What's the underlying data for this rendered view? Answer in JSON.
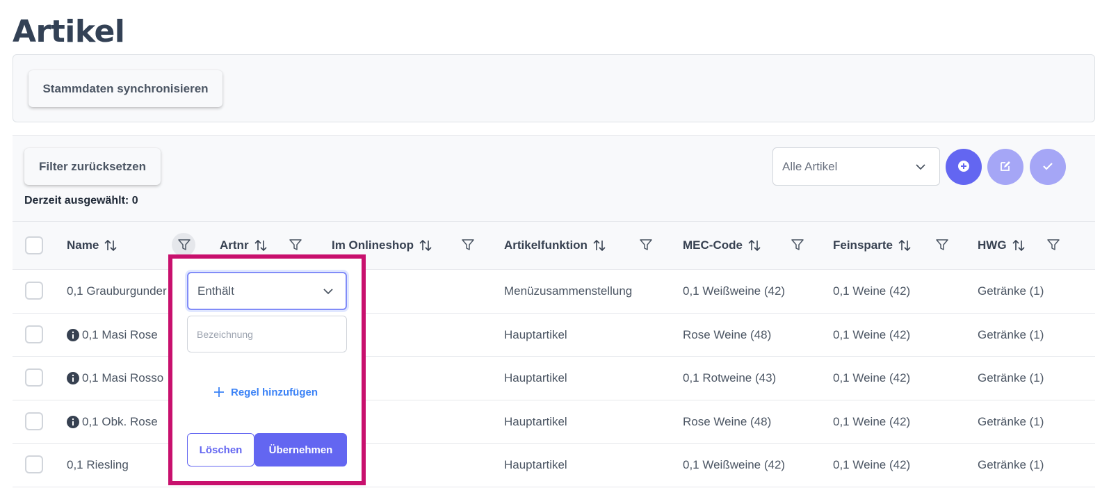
{
  "page": {
    "title": "Artikel"
  },
  "top_panel": {
    "sync_label": "Stammdaten synchronisieren"
  },
  "toolbar": {
    "reset_label": "Filter zurücksetzen",
    "selected_text": "Derzeit ausgewählt: 0",
    "article_filter": {
      "selected": "Alle Artikel"
    },
    "actions": [
      {
        "icon": "plus-circle-icon",
        "color": "#6366f1",
        "enabled": true
      },
      {
        "icon": "edit-icon",
        "color": "#a5a6f6",
        "enabled": false
      },
      {
        "icon": "check-icon",
        "color": "#a5a6f6",
        "enabled": false
      }
    ]
  },
  "table": {
    "columns": [
      {
        "label": "Name",
        "sortable": true,
        "filter_active": true
      },
      {
        "label": "Artnr",
        "sortable": true,
        "filter_active": false
      },
      {
        "label": "Im Onlineshop",
        "sortable": true,
        "filter_active": false
      },
      {
        "label": "Artikelfunktion",
        "sortable": true,
        "filter_active": false
      },
      {
        "label": "MEC-Code",
        "sortable": true,
        "filter_active": false
      },
      {
        "label": "Feinsparte",
        "sortable": true,
        "filter_active": false
      },
      {
        "label": "HWG",
        "sortable": true,
        "filter_active": false
      }
    ],
    "rows": [
      {
        "name": "0,1 Grauburgunder",
        "info": false,
        "function": "Menüzusammenstellung",
        "mec": "0,1 Weißweine (42)",
        "feinsparte": "0,1 Weine (42)",
        "hwg": "Getränke (1)"
      },
      {
        "name": "0,1 Masi Rose",
        "info": true,
        "function": "Hauptartikel",
        "mec": "Rose Weine (48)",
        "feinsparte": "0,1 Weine (42)",
        "hwg": "Getränke (1)"
      },
      {
        "name": "0,1 Masi Rosso",
        "info": true,
        "function": "Hauptartikel",
        "mec": "0,1 Rotweine (43)",
        "feinsparte": "0,1 Weine (42)",
        "hwg": "Getränke (1)"
      },
      {
        "name": "0,1 Obk. Rose",
        "info": true,
        "function": "Hauptartikel",
        "mec": "Rose Weine (48)",
        "feinsparte": "0,1 Weine (42)",
        "hwg": "Getränke (1)"
      },
      {
        "name": "0,1 Riesling",
        "info": false,
        "function": "Hauptartikel",
        "mec": "0,1 Weißweine (42)",
        "feinsparte": "0,1 Weine (42)",
        "hwg": "Getränke (1)"
      }
    ]
  },
  "filter_overlay": {
    "operator": "Enthält",
    "value_placeholder": "Bezeichnung",
    "value": "",
    "add_rule_label": "Regel hinzufügen",
    "delete_label": "Löschen",
    "apply_label": "Übernehmen",
    "highlight_color": "#c8106d"
  }
}
